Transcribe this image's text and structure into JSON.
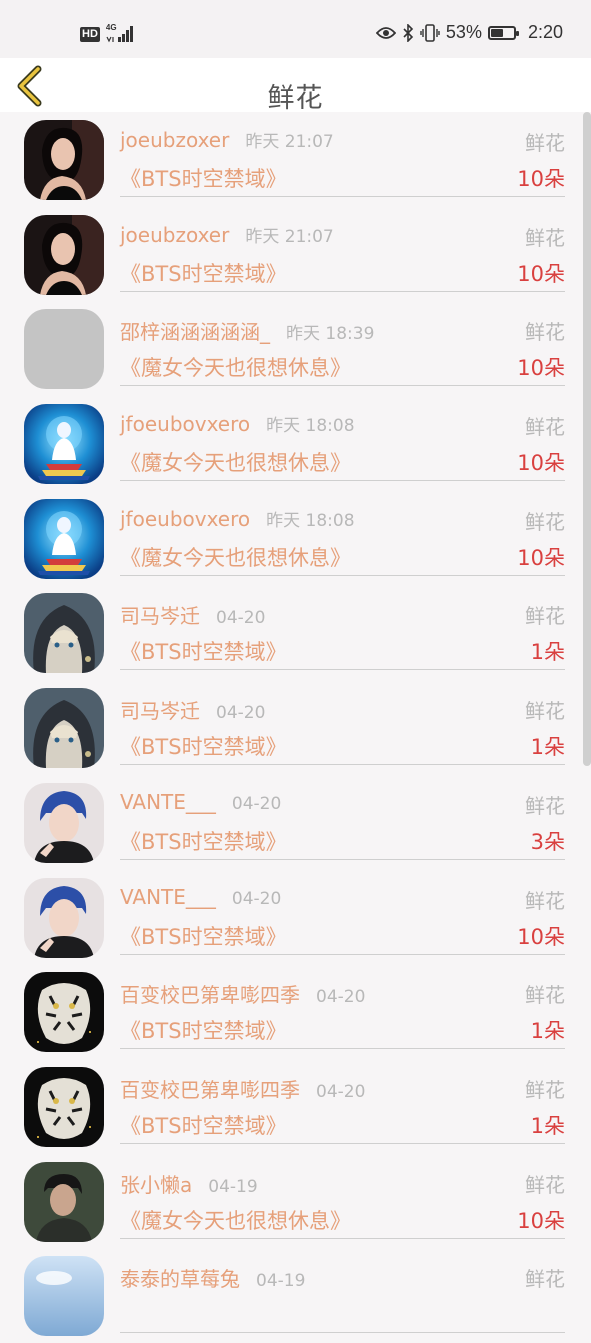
{
  "status_bar": {
    "hd": "HD",
    "network": "4G",
    "battery_percent": "53%",
    "battery_level": 0.53,
    "time": "2:20"
  },
  "header": {
    "title": "鲜花"
  },
  "items": [
    {
      "user": "joeubzoxer",
      "time": "昨天 21:07",
      "type": "鲜花",
      "book": "《BTS时空禁域》",
      "count": "10朵",
      "avatar": "woman-portrait"
    },
    {
      "user": "joeubzoxer",
      "time": "昨天 21:07",
      "type": "鲜花",
      "book": "《BTS时空禁域》",
      "count": "10朵",
      "avatar": "woman-portrait"
    },
    {
      "user": "邵梓涵涵涵涵涵_",
      "time": "昨天 18:39",
      "type": "鲜花",
      "book": "《魔女今天也很想休息》",
      "count": "10朵",
      "avatar": "placeholder-gray"
    },
    {
      "user": "jfoeubovxero",
      "time": "昨天 18:08",
      "type": "鲜花",
      "book": "《魔女今天也很想休息》",
      "count": "10朵",
      "avatar": "deity-blue"
    },
    {
      "user": "jfoeubovxero",
      "time": "昨天 18:08",
      "type": "鲜花",
      "book": "《魔女今天也很想休息》",
      "count": "10朵",
      "avatar": "deity-blue"
    },
    {
      "user": "司马岑迁",
      "time": "04-20",
      "type": "鲜花",
      "book": "《BTS时空禁域》",
      "count": "1朵",
      "avatar": "anime-hood"
    },
    {
      "user": "司马岑迁",
      "time": "04-20",
      "type": "鲜花",
      "book": "《BTS时空禁域》",
      "count": "1朵",
      "avatar": "anime-hood"
    },
    {
      "user": "VANTE___",
      "time": "04-20",
      "type": "鲜花",
      "book": "《BTS时空禁域》",
      "count": "3朵",
      "avatar": "man-blue-hair"
    },
    {
      "user": "VANTE___",
      "time": "04-20",
      "type": "鲜花",
      "book": "《BTS时空禁域》",
      "count": "10朵",
      "avatar": "man-blue-hair"
    },
    {
      "user": "百变校巴第卑嘭四季",
      "time": "04-20",
      "type": "鲜花",
      "book": "《BTS时空禁域》",
      "count": "1朵",
      "avatar": "white-tiger"
    },
    {
      "user": "百变校巴第卑嘭四季",
      "time": "04-20",
      "type": "鲜花",
      "book": "《BTS时空禁域》",
      "count": "1朵",
      "avatar": "white-tiger"
    },
    {
      "user": "张小懒a",
      "time": "04-19",
      "type": "鲜花",
      "book": "《魔女今天也很想休息》",
      "count": "10朵",
      "avatar": "man-dark"
    },
    {
      "user": "泰泰的草莓兔",
      "time": "04-19",
      "type": "鲜花",
      "book": "",
      "count": "",
      "avatar": "sky-blue"
    }
  ]
}
